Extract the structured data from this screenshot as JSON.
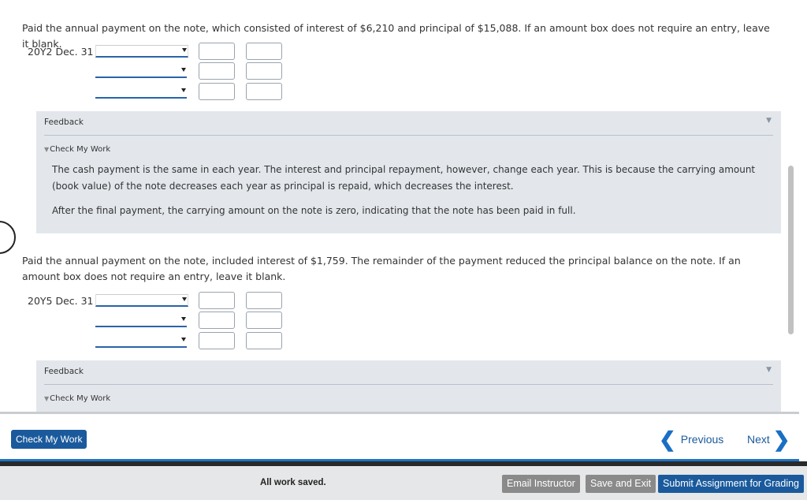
{
  "section1": {
    "instruction": "Paid the annual payment on the note, which consisted of interest of $6,210 and principal of $15,088. If an amount box does not require an entry, leave it blank.",
    "date": "20Y2 Dec. 31"
  },
  "feedback1": {
    "title": "Feedback",
    "toggle": "Check My Work",
    "paragraph1": "The cash payment is the same in each year. The interest and principal repayment, however, change each year. This is because the carrying amount (book value) of the note decreases each year as principal is repaid, which decreases the interest.",
    "paragraph2": "After the final payment, the carrying amount on the note is zero, indicating that the note has been paid in full."
  },
  "section2": {
    "instruction": "Paid the annual payment on the note, included interest of $1,759. The remainder of the payment reduced the principal balance on the note. If an amount box does not require an entry, leave it blank.",
    "date": "20Y5 Dec. 31"
  },
  "feedback2": {
    "title": "Feedback",
    "toggle": "Check My Work"
  },
  "nav": {
    "check_my_work": "Check My Work",
    "previous": "Previous",
    "next": "Next"
  },
  "footer": {
    "status": "All work saved.",
    "email_instructor": "Email Instructor",
    "save_and_exit": "Save and Exit",
    "submit": "Submit Assignment for Grading"
  },
  "colors": {
    "primary": "#1a5a9c",
    "feedback_bg": "#e3e7ec",
    "footer_bg": "#e6e7e8",
    "secondary_button": "#8a8a8a"
  }
}
